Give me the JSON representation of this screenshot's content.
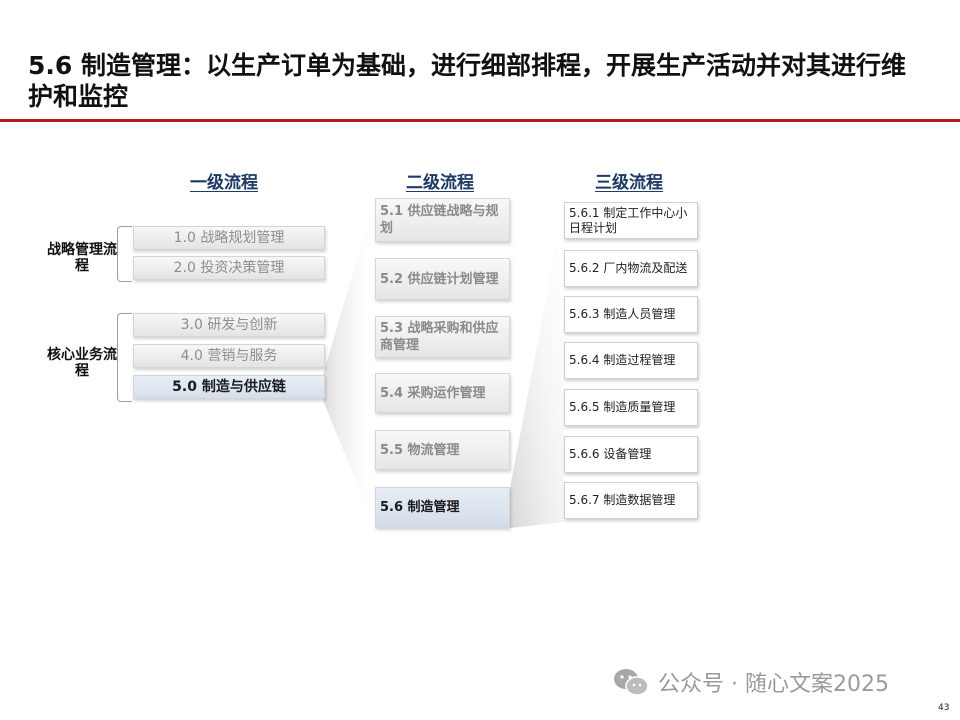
{
  "title": "5.6 制造管理：以生产订单为基础，进行细部排程，开展生产活动并对其进行维护和监控",
  "columns": {
    "level1": "一级流程",
    "level2": "二级流程",
    "level3": "三级流程"
  },
  "groups": {
    "strategy": "战略管理流程",
    "core": "核心业务流程"
  },
  "level1_items": [
    "1.0 战略规划管理",
    "2.0 投资决策管理",
    "3.0 研发与创新",
    "4.0 营销与服务",
    "5.0 制造与供应链"
  ],
  "level2_items": [
    "5.1 供应链战略与规划",
    "5.2 供应链计划管理",
    "5.3 战略采购和供应商管理",
    "5.4 采购运作管理",
    "5.5 物流管理",
    "5.6 制造管理"
  ],
  "level3_items": [
    "5.6.1 制定工作中心小日程计划",
    "5.6.2 厂内物流及配送",
    "5.6.3 制造人员管理",
    "5.6.4 制造过程管理",
    "5.6.5 制造质量管理",
    "5.6.6 设备管理",
    "5.6.7 制造数据管理"
  ],
  "watermark": "公众号 · 随心文案2025",
  "page_number": "43",
  "colors": {
    "accent_red": "#b01e23",
    "header_navy": "#1f3a64",
    "active_fill": "#d5dfec"
  }
}
